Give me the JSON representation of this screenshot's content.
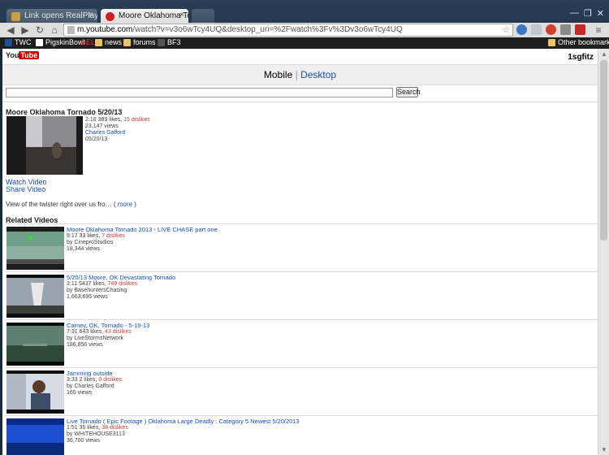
{
  "browser": {
    "tabs": [
      {
        "title": "Link opens RealPlayer - W",
        "active": false
      },
      {
        "title": "Moore Oklahoma Tornad",
        "active": true
      }
    ],
    "url_host": "m.youtube.com",
    "url_rest": "/watch?v=v3o6wTcy4UQ&desktop_uri=%2Fwatch%3Fv%3Dv3o6wTcy4UQ",
    "bookmarks": [
      "TWC",
      "PigskinBowl",
      "BEL",
      "news",
      "forums",
      "BF3"
    ],
    "other_bookmarks": "Other bookmarks",
    "window_buttons": [
      "—",
      "❐",
      "✕"
    ]
  },
  "header": {
    "logo_you": "You",
    "logo_tube": "Tube",
    "username": "1sgfitz"
  },
  "switch": {
    "mobile": "Mobile",
    "separator": "|",
    "desktop": "Desktop"
  },
  "search": {
    "button": "Search",
    "value": ""
  },
  "video": {
    "title": "Moore Oklahoma Tornado 5/20/13",
    "duration": "2:18",
    "likes": "389 likes,",
    "dislikes": "15 dislikes",
    "views": "23,147 views",
    "uploader": "Charles Gafford",
    "date": "05/20/13",
    "watch": "Watch Video",
    "share": "Share Video",
    "description": "View of the twister right over us fro…",
    "more_open": "(",
    "more": "more",
    "more_close": ")"
  },
  "related_heading": "Related Videos",
  "related": [
    {
      "title": "Moore Oklahoma Tornado 2013 - LIVE CHASE part one",
      "duration": "9:17",
      "likes": "33 likes,",
      "dislikes": "7 dislikes",
      "by": "by CineproStudios",
      "views": "18,344 views"
    },
    {
      "title": "5/20/13 Moore, OK Devastating Tornado",
      "duration": "3:11",
      "likes": "5437 likes,",
      "dislikes": "749 dislikes",
      "by": "by BasehuntersChasing",
      "views": "1,663,695 views"
    },
    {
      "title": "Carney, OK, Tornado - 5-19-13",
      "duration": "7:31",
      "likes": "643 likes,",
      "dislikes": "43 dislikes",
      "by": "by LiveStormsNetwork",
      "views": "186,856 views"
    },
    {
      "title": "Jamming outside",
      "duration": "3:33",
      "likes": "2 likes,",
      "dislikes": "0 dislikes",
      "by": "by Charles Gafford",
      "views": "165 views"
    },
    {
      "title": "Live Tornado ( Epic Footage ) Oklahoma Large Deadly : Category 5 Newest 5/20/2013",
      "duration": "1:51",
      "likes": "35 likes,",
      "dislikes": "38 dislikes",
      "by": "by WHITEHOUSE3113",
      "views": "36,700 views"
    }
  ]
}
